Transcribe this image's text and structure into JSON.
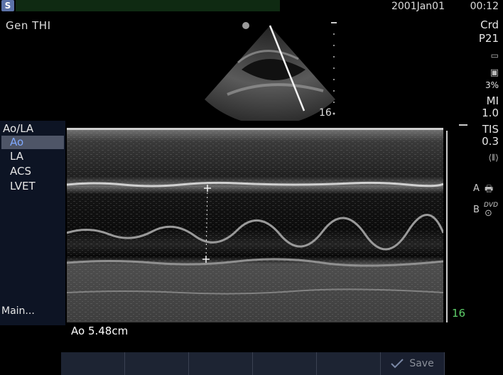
{
  "header": {
    "date": "2001Jan01",
    "time": "00:12",
    "mode_label": "Gen  THI"
  },
  "right_panel": {
    "preset": "Crd",
    "probe": "P21",
    "percent": "3%",
    "mi_label": "MI",
    "mi_value": "1.0",
    "tis_label": "TIS",
    "tis_value": "0.3",
    "marker_a": "A",
    "marker_b": "B",
    "dvd_label": "DVD"
  },
  "sector": {
    "depth_label": "16"
  },
  "menu": {
    "title": "Ao/LA",
    "items": [
      "Ao",
      "LA",
      "ACS",
      "LVET"
    ],
    "selected": "Ao",
    "main_link": "Main..."
  },
  "mmode": {
    "depth_label": "16"
  },
  "measurement": {
    "text": "Ao 5.48cm"
  },
  "softkeys": {
    "save_label": "Save"
  },
  "colors": {
    "menu_selected_text": "#7fa8ff",
    "depth_green": "#5fcf6a",
    "menu_bg": "#0d1424"
  }
}
